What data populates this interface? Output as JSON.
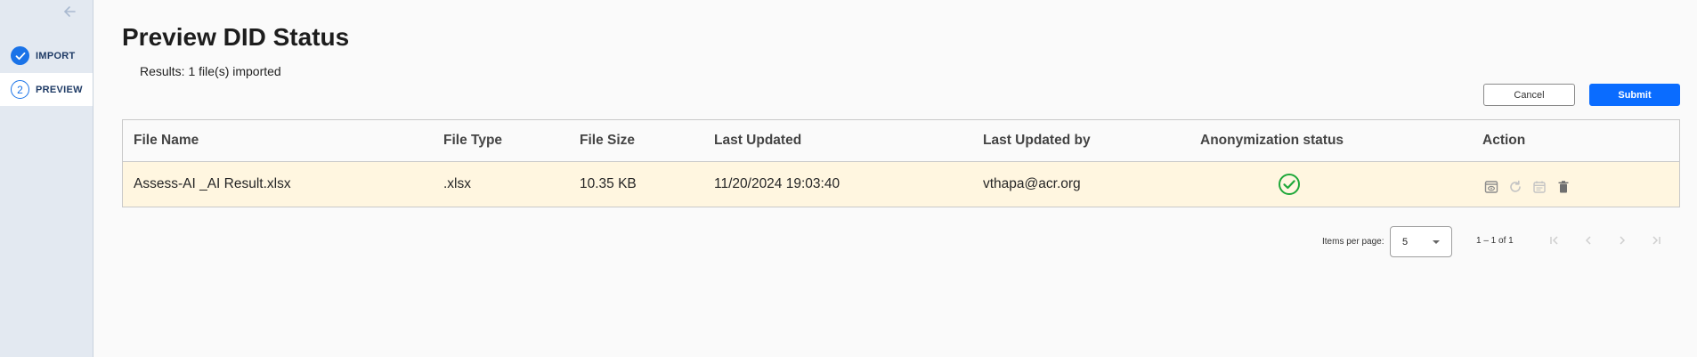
{
  "sidebar": {
    "back_icon": "arrow-left-icon",
    "steps": [
      {
        "number": "",
        "label": "IMPORT",
        "state": "completed",
        "icon": "check-icon"
      },
      {
        "number": "2",
        "label": "PREVIEW",
        "state": "active"
      }
    ]
  },
  "page": {
    "title": "Preview DID Status",
    "results": "Results: 1 file(s) imported"
  },
  "toolbar": {
    "cancel_label": "Cancel",
    "submit_label": "Submit"
  },
  "table": {
    "headers": [
      "File Name",
      "File Type",
      "File Size",
      "Last Updated",
      "Last Updated by",
      "Anonymization status",
      "Action"
    ],
    "rows": [
      {
        "file_name": "Assess-AI _AI Result.xlsx",
        "file_type": ".xlsx",
        "file_size": "10.35 KB",
        "last_updated": "11/20/2024 19:03:40",
        "last_updated_by": "vthapa@acr.org",
        "anonymization_status": "success",
        "status_icon": "check-circle-icon",
        "actions": [
          "preview-icon",
          "refresh-icon",
          "calendar-icon",
          "delete-icon"
        ]
      }
    ]
  },
  "pagination": {
    "items_per_page_label": "Items per page:",
    "items_per_page_value": "5",
    "range_label": "1 – 1 of 1"
  },
  "colors": {
    "accent": "#0a6cff",
    "row_highlight": "#fff6e0",
    "success": "#1fa83a",
    "sidebar_bg": "#e3e9f1"
  }
}
